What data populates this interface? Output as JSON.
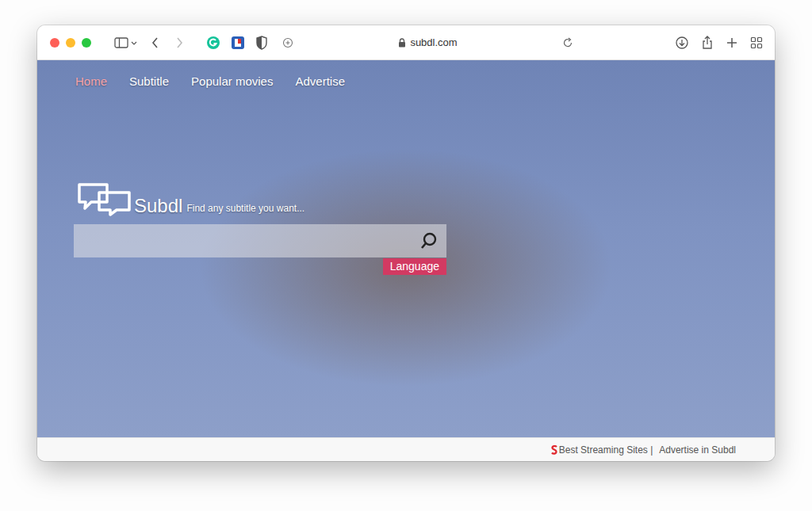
{
  "browser": {
    "address": "subdl.com",
    "secure": true
  },
  "nav": [
    {
      "label": "Home",
      "selected": true
    },
    {
      "label": "Subtitle",
      "selected": false
    },
    {
      "label": "Popular movies",
      "selected": false
    },
    {
      "label": "Advertise",
      "selected": false
    }
  ],
  "brand": {
    "name": "Subdl",
    "tagline": "Find any subtitle you want..."
  },
  "search": {
    "value": ""
  },
  "language_button": "Language",
  "footer": {
    "links": [
      "Best Streaming Sites |",
      "Advertise in Subdl"
    ]
  }
}
